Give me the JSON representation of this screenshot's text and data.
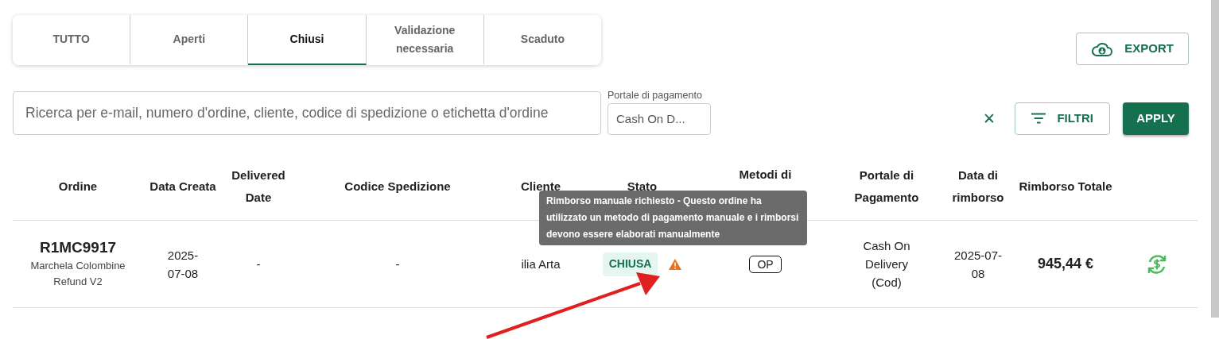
{
  "tabs": [
    {
      "label": "TUTTO",
      "selected": false
    },
    {
      "label": "Aperti",
      "selected": false
    },
    {
      "label": "Chiusi",
      "selected": true
    },
    {
      "label": "Validazione necessaria",
      "selected": false
    },
    {
      "label": "Scaduto",
      "selected": false
    }
  ],
  "export_button": "EXPORT",
  "search": {
    "placeholder": "Ricerca per e-mail, numero d'ordine, cliente, codice di spedizione o etichetta d'ordine"
  },
  "payment_portal_filter": {
    "label": "Portale di pagamento",
    "value": "Cash On D..."
  },
  "clear_button": "✕",
  "filters_button": "FILTRI",
  "apply_button": "APPLY",
  "table": {
    "columns": [
      "Ordine",
      "Data Creata",
      "Delivered Date",
      "Codice Spedizione",
      "Cliente",
      "Stato",
      "Metodi di",
      "Portale di Pagamento",
      "Data di rimborso",
      "Rimborso Totale"
    ],
    "rows": [
      {
        "order_number": "R1MC9917",
        "order_label": "Marchela Colombine Refund V2",
        "created": "2025-07-08",
        "delivered": "-",
        "shipping_code": "-",
        "customer": "ilia Arta",
        "status": "CHIUSA",
        "warning": true,
        "refund_method": "OP",
        "payment_portal": "Cash On Delivery (Cod)",
        "refund_date": "2025-07-08",
        "total": "945,44 €"
      }
    ]
  },
  "tooltip": "Rimborso manuale richiesto - Questo ordine ha utilizzato un metodo di pagamento manuale e i rimborsi devono essere elaborati manualmente"
}
